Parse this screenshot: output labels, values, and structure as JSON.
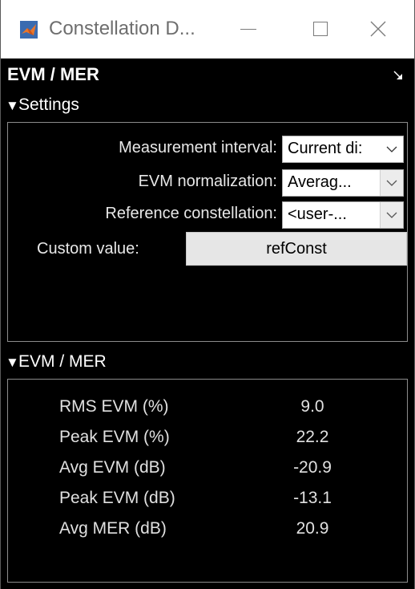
{
  "window": {
    "title": "Constellation D...",
    "controls": {
      "minimize": "minimize",
      "maximize": "maximize",
      "close": "close"
    }
  },
  "panel": {
    "title": "EVM / MER"
  },
  "settings": {
    "header": "Settings",
    "rows": [
      {
        "label": "Measurement interval:",
        "value": "Current di:"
      },
      {
        "label": "EVM normalization:",
        "value": "Averag..."
      },
      {
        "label": "Reference constellation:",
        "value": "<user-..."
      }
    ],
    "custom_label": "Custom value:",
    "custom_value": "refConst"
  },
  "evm": {
    "header": "EVM / MER",
    "metrics": [
      {
        "name": "RMS EVM (%)",
        "value": "9.0"
      },
      {
        "name": "Peak EVM (%)",
        "value": "22.2"
      },
      {
        "name": "Avg EVM (dB)",
        "value": "-20.9"
      },
      {
        "name": "Peak EVM (dB)",
        "value": "-13.1"
      },
      {
        "name": "Avg MER (dB)",
        "value": "20.9"
      }
    ]
  },
  "icons": {
    "app": "matlab-icon",
    "collapse": "triangle-down-icon",
    "undock": "undock-arrow-icon",
    "dropdown": "chevron-down-icon"
  },
  "colors": {
    "background": "#000000",
    "text": "#e8e8e8",
    "titlebar": "#ffffff"
  }
}
